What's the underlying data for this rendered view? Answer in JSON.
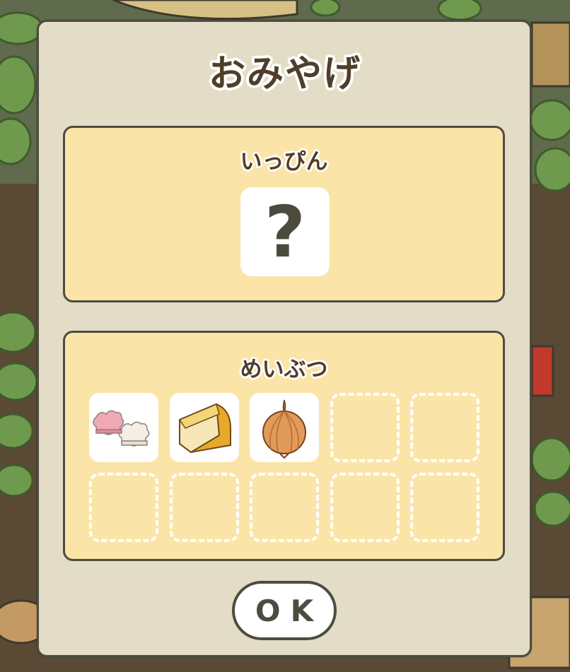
{
  "dialog": {
    "title": "おみやげ",
    "ok_label": "OK"
  },
  "specialty_panel": {
    "label": "いっぴん",
    "slot_content": "?"
  },
  "souvenirs_panel": {
    "label": "めいぶつ",
    "items": [
      {
        "icon": "sakura-fu-icon",
        "filled": true
      },
      {
        "icon": "cheese-icon",
        "filled": true
      },
      {
        "icon": "onion-icon",
        "filled": true
      },
      {
        "filled": false
      },
      {
        "filled": false
      },
      {
        "filled": false
      },
      {
        "filled": false
      },
      {
        "filled": false
      },
      {
        "filled": false
      },
      {
        "filled": false
      }
    ]
  },
  "colors": {
    "dialog_bg": "#e3dcc6",
    "panel_bg": "#fbe4a7",
    "border": "#4d4c40",
    "title_text": "#4f3e2a"
  }
}
